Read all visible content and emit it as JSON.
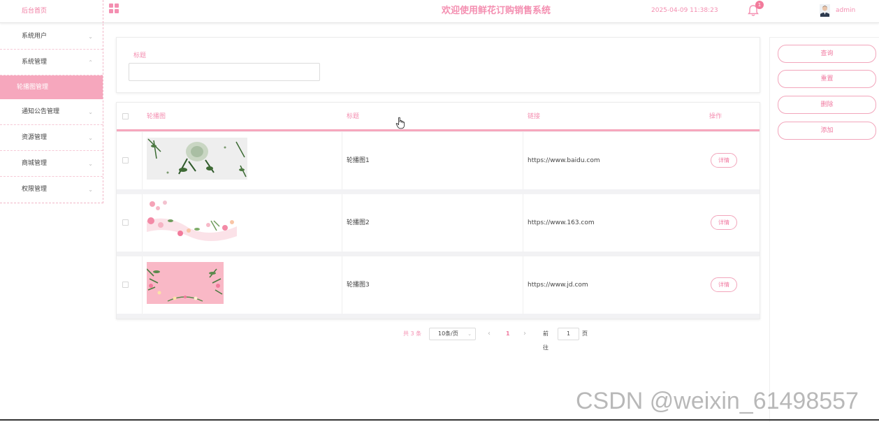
{
  "header": {
    "home": "后台首页",
    "title": "欢迎使用鲜花订购销售系统",
    "datetime": "2025-04-09 11:38:23",
    "notification_count": "1",
    "username": "admin"
  },
  "sidebar": {
    "items": [
      {
        "label": "系统用户",
        "expanded": false
      },
      {
        "label": "系统管理",
        "expanded": true,
        "children": [
          {
            "label": "轮播图管理",
            "active": true
          }
        ]
      },
      {
        "label": "通知公告管理",
        "expanded": false
      },
      {
        "label": "资源管理",
        "expanded": false
      },
      {
        "label": "商城管理",
        "expanded": false
      },
      {
        "label": "权限管理",
        "expanded": false
      }
    ]
  },
  "search": {
    "label": "标题",
    "value": ""
  },
  "table": {
    "columns": [
      "轮播图",
      "标题",
      "链接",
      "操作"
    ],
    "rows": [
      {
        "title": "轮播图1",
        "link": "https://www.baidu.com",
        "action": "详情"
      },
      {
        "title": "轮播图2",
        "link": "https://www.163.com",
        "action": "详情"
      },
      {
        "title": "轮播图3",
        "link": "https://www.jd.com",
        "action": "详情"
      }
    ]
  },
  "pagination": {
    "total": "共 3 条",
    "page_size": "10条/页",
    "current_page": "1",
    "goto_label": "前往",
    "goto_value": "1",
    "page_suffix": "页"
  },
  "actions": [
    "查询",
    "重置",
    "删除",
    "添加"
  ],
  "watermark": "CSDN @weixin_61498557",
  "colors": {
    "accent": "#f48fb1",
    "active_menu": "#f6a7bd"
  },
  "icons": {
    "layout": "grid-icon",
    "notification": "bell-icon",
    "user": "avatar-icon",
    "cursor": "hand-pointer-icon"
  }
}
